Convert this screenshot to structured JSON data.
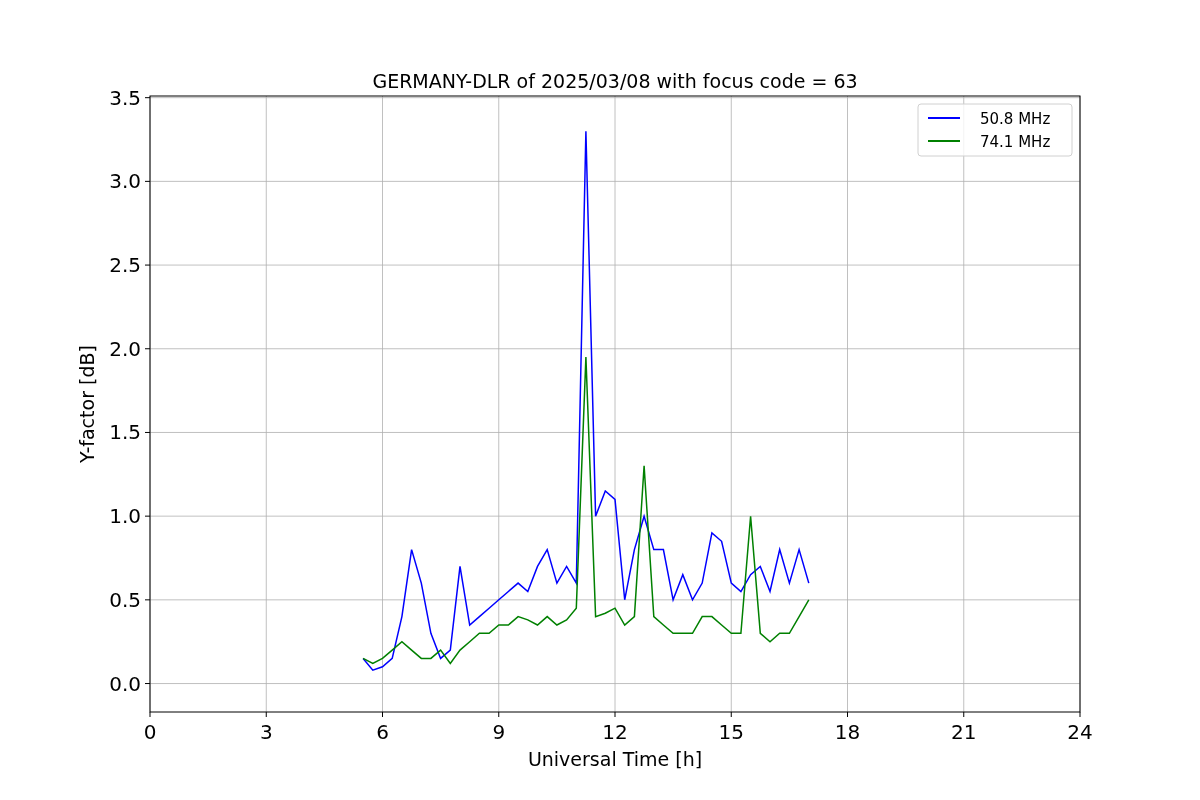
{
  "chart_data": {
    "type": "line",
    "title": "GERMANY-DLR of 2025/03/08 with focus code = 63",
    "xlabel": "Universal Time [h]",
    "ylabel": "Y-factor [dB]",
    "x": [
      5.5,
      5.75,
      6,
      6.25,
      6.5,
      6.75,
      7,
      7.25,
      7.5,
      7.75,
      8,
      8.25,
      8.5,
      8.75,
      9,
      9.25,
      9.5,
      9.75,
      10,
      10.25,
      10.5,
      10.75,
      11,
      11.25,
      11.5,
      11.75,
      12,
      12.25,
      12.5,
      12.75,
      13,
      13.25,
      13.5,
      13.75,
      14,
      14.25,
      14.5,
      14.75,
      15,
      15.25,
      15.5,
      15.75,
      16,
      16.25,
      16.5,
      16.75,
      17
    ],
    "series": [
      {
        "name": "50.8 MHz",
        "color": "#0000ff",
        "values": [
          0.15,
          0.08,
          0.1,
          0.15,
          0.4,
          0.8,
          0.6,
          0.3,
          0.15,
          0.2,
          0.7,
          0.35,
          0.4,
          0.45,
          0.5,
          0.55,
          0.6,
          0.55,
          0.7,
          0.8,
          0.6,
          0.7,
          0.6,
          3.3,
          1.0,
          1.15,
          1.1,
          0.5,
          0.8,
          1.0,
          0.8,
          0.8,
          0.5,
          0.65,
          0.5,
          0.6,
          0.9,
          0.85,
          0.6,
          0.55,
          0.65,
          0.7,
          0.55,
          0.8,
          0.6,
          0.8,
          0.6
        ]
      },
      {
        "name": "74.1 MHz",
        "color": "#008000",
        "values": [
          0.15,
          0.12,
          0.15,
          0.2,
          0.25,
          0.2,
          0.15,
          0.15,
          0.2,
          0.12,
          0.2,
          0.25,
          0.3,
          0.3,
          0.35,
          0.35,
          0.4,
          0.38,
          0.35,
          0.4,
          0.35,
          0.38,
          0.45,
          1.95,
          0.4,
          0.42,
          0.45,
          0.35,
          0.4,
          1.3,
          0.4,
          0.35,
          0.3,
          0.3,
          0.3,
          0.4,
          0.4,
          0.35,
          0.3,
          0.3,
          1.0,
          0.3,
          0.25,
          0.3,
          0.3,
          0.4,
          0.5
        ]
      }
    ],
    "grid": true,
    "legend": true,
    "xlim": [
      0,
      24
    ],
    "ylim": [
      -0.17,
      3.51
    ],
    "xticks": [
      0,
      3,
      6,
      9,
      12,
      15,
      18,
      21,
      24
    ],
    "yticks": [
      {
        "value": 0,
        "label": "0.0"
      },
      {
        "value": 0.5,
        "label": "0.5"
      },
      {
        "value": 1,
        "label": "1.0"
      },
      {
        "value": 1.5,
        "label": "1.5"
      },
      {
        "value": 2,
        "label": "2.0"
      },
      {
        "value": 2.5,
        "label": "2.5"
      },
      {
        "value": 3,
        "label": "3.0"
      },
      {
        "value": 3.5,
        "label": "3.5"
      }
    ]
  }
}
